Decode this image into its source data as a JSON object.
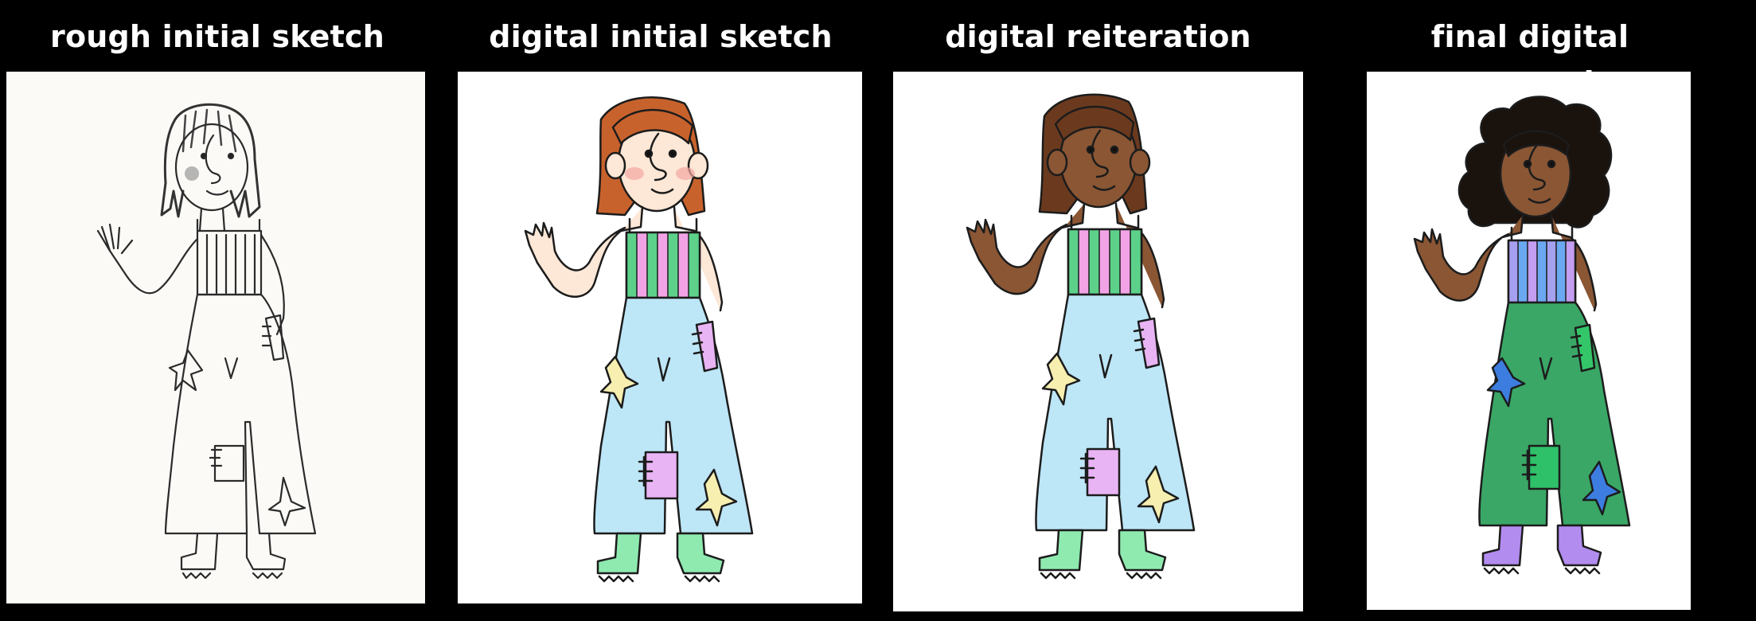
{
  "panels": [
    {
      "title": "rough initial sketch"
    },
    {
      "title": "digital initial sketch"
    },
    {
      "title": "digital reiteration"
    },
    {
      "title": "final digital concept"
    }
  ]
}
